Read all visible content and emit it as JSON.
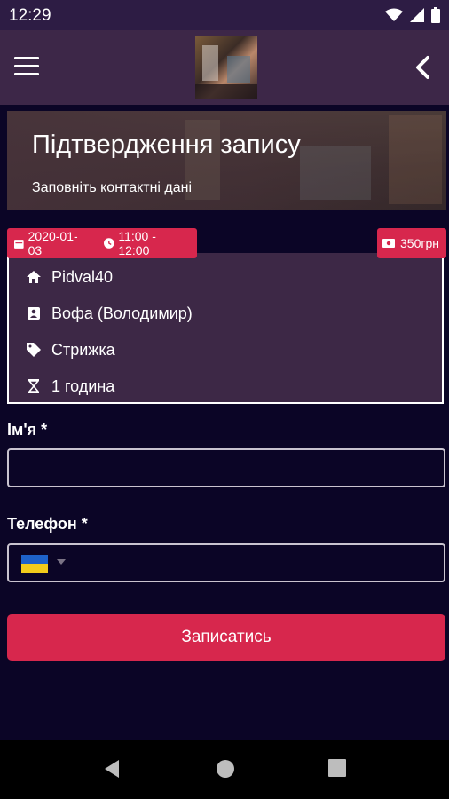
{
  "status_bar": {
    "time": "12:29"
  },
  "header": {
    "title": "Підтвердження запису",
    "subtitle": "Заповніть контактні дані"
  },
  "booking": {
    "date": "2020-01-03",
    "time_range": "11:00 - 12:00",
    "price": "350грн",
    "location": "Pidval40",
    "master": "Вофа (Володимир)",
    "service": "Стрижка",
    "duration": "1 година"
  },
  "form": {
    "name_label": "Ім'я *",
    "name_value": "",
    "phone_label": "Телефон *",
    "phone_value": "",
    "submit_label": "Записатись"
  },
  "colors": {
    "accent": "#d7274d",
    "background": "#0b0526",
    "card": "#3d2846",
    "appbar": "#3d2748"
  }
}
